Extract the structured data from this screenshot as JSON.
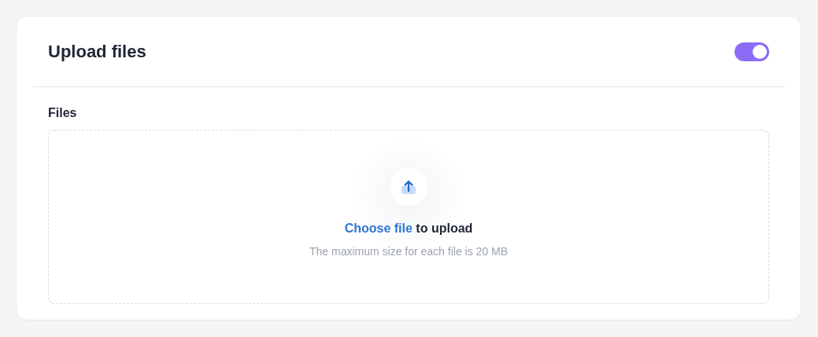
{
  "card": {
    "title": "Upload files",
    "toggle": {
      "on": true
    }
  },
  "field": {
    "label": "Files",
    "dropzone": {
      "link": "Choose file",
      "prompt": " to upload",
      "hint": "The maximum size for each file is 20 MB"
    }
  }
}
